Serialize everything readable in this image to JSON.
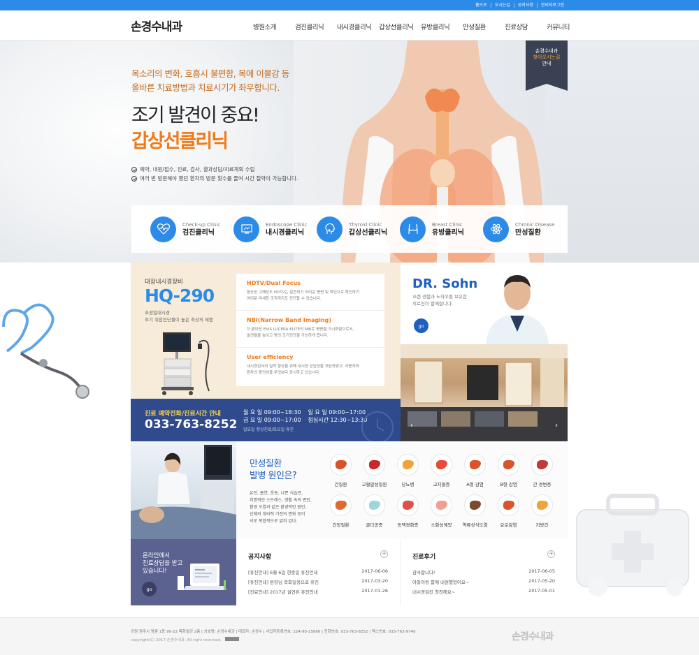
{
  "util_links": [
    "홈으로",
    "오시는길",
    "공지사항",
    "관리자로그인"
  ],
  "logo": "손경수내과",
  "nav": [
    "병원소개",
    "검진클리닉",
    "내시경클리닉",
    "갑상선클리닉",
    "유방클리닉",
    "만성질환",
    "진료상담",
    "커뮤니티"
  ],
  "hero": {
    "sub1": "목소리의 변화, 호흡시 불편함, 목에 이물감 등",
    "sub2": "올바른 치료방법과 치료시기가 좌우합니다.",
    "title1": "조기 발견이 중요!",
    "title2": "갑상선클리닉",
    "check1": "예약, 내원/접수, 진료, 검사, 결과상담/치료계획 수립",
    "check2": "여러 번 방문해야 했던 환자의 방문 횟수를 줄여 시간 절약이 가능합니다."
  },
  "badge": {
    "l1": "손경수내과",
    "l2": "찾아오시는길",
    "l3": "안내"
  },
  "clinics": [
    {
      "en": "Check-up Clinic",
      "ko": "검진클리닉",
      "icon": "heartbeat-icon"
    },
    {
      "en": "Endoscope Clinic",
      "ko": "내시경클리닉",
      "icon": "monitor-icon"
    },
    {
      "en": "Thyroid Clinic",
      "ko": "갑상선클리닉",
      "icon": "head-icon"
    },
    {
      "en": "Breast Clinic",
      "ko": "유방클리닉",
      "icon": "torso-icon"
    },
    {
      "en": "Chronic Disease",
      "ko": "만성질환",
      "icon": "atom-icon"
    }
  ],
  "promo": {
    "label": "대장내시경장비",
    "model": "HQ-290",
    "desc1": "초정밀내시경",
    "desc2": "조기 위암진단률이 높은 최상의 제품"
  },
  "features": [
    {
      "title": "HDTV/Dual Focus",
      "d1": "향상된 고해상도 HDTV는 발견되기 어려운 병변 및 확인으로 확인하기",
      "d2": "어려운 미세한 조직까지도 진단할 수 있습니다."
    },
    {
      "title": "NBI(Narrow Band Imaging)",
      "d1": "더 밝아진 EVIS LUCERA ELITE의 NBI로 병변을 가시화함으로서,",
      "d2": "발견율을 높이고 병의 조기진단을 가능하게 합니다."
    },
    {
      "title": "User efficiency",
      "d1": "내시경검사의 질적 향상을 위해 내시경 삽입성을 개선하였고, 사용자와",
      "d2": "환자의 편의성을 무엇보다 중시하고 있습니다."
    }
  ],
  "doctor": {
    "name": "DR. Sohn",
    "d1": "오랜 경험과 노하우를 보유한",
    "d2": "의료진이 함께합니다.",
    "go": "go"
  },
  "hours": {
    "title": "진료 예약전화/진료시간 안내",
    "tel": "033-763-8252",
    "r1a": "월 요 일  09:00~18:30",
    "r1b": "일 요 일  09:00~17:00",
    "r2a": "금 요 일  09:00~17:00",
    "r2b": "점심시간  12:30~13:30",
    "note": "일요일 정상진료/토요일 휴진"
  },
  "chronic": {
    "t1": "만성질환",
    "t2": "발병 원인은?",
    "desc": [
      "유전, 흡연, 운동, 나쁜 식습관,",
      "치명적인 스트레스, 생활 속의 변인,",
      "환경 오염과 같은 환경적인 원인,",
      "신체의 생리적 기전의 변화 등이",
      "서로 복합적으로 얽혀 있다."
    ],
    "diseases": [
      {
        "label": "간질환",
        "color": "#d9542b",
        "icon": "liver-icon"
      },
      {
        "label": "고혈압성질환",
        "color": "#c8282d",
        "icon": "heart-icon"
      },
      {
        "label": "당뇨병",
        "color": "#f2a23a",
        "icon": "pancreas-icon"
      },
      {
        "label": "고지혈증",
        "color": "#e84a3a",
        "icon": "vessel-icon"
      },
      {
        "label": "A형 감염",
        "color": "#d9542b",
        "icon": "liver-icon"
      },
      {
        "label": "B형 감염",
        "color": "#d9542b",
        "icon": "liver-icon"
      },
      {
        "label": "간 경변증",
        "color": "#c03a3a",
        "icon": "cirrhosis-icon"
      },
      {
        "label": "간장질환",
        "color": "#e06a2f",
        "icon": "liver-icon"
      },
      {
        "label": "골다공증",
        "color": "#9fd6d8",
        "icon": "bone-icon"
      },
      {
        "label": "동맥경화증",
        "color": "#e0504a",
        "icon": "artery-icon"
      },
      {
        "label": "소화성궤양",
        "color": "#f0a090",
        "icon": "stomach-icon"
      },
      {
        "label": "역류성식도염",
        "color": "#7a4a2a",
        "icon": "esophagus-icon"
      },
      {
        "label": "요로감염",
        "color": "#d9542b",
        "icon": "kidney-icon"
      },
      {
        "label": "지방간",
        "color": "#f2a23a",
        "icon": "fatty-liver-icon"
      }
    ]
  },
  "consult": {
    "l1": "온라인에서",
    "l2": "진료상담을 받고",
    "l3": "있습니다!",
    "go": "go"
  },
  "notice": {
    "title": "공지사항",
    "rows": [
      {
        "t": "[휴진안내] 6월 6일 현충일 휴진안내",
        "d": "2017-06-06"
      },
      {
        "t": "[휴진안내] 원장님 학회일정으로 휴진",
        "d": "2017-03-20"
      },
      {
        "t": "[진료안내] 2017년 설연휴 휴진안내",
        "d": "2017-01-26"
      }
    ]
  },
  "review": {
    "title": "진료후기",
    "rows": [
      {
        "t": "감사합니다!",
        "d": "2017-06-05"
      },
      {
        "t": "아들이랑 함께 내원했었어요~",
        "d": "2017-05-20"
      },
      {
        "t": "내시경검진 칭찬해요~",
        "d": "2017-05-01"
      }
    ]
  },
  "footer": {
    "line1": "강원 원주시 명륜 1동 90-22 목화빌딩 2층 | 상호명: 손경수내과 | 대표자: 손경수 | 사업자등록번호: 224-90-15866 | 전화번호: 033-763-8252 | 팩스번호: 033-763-9740",
    "line2": "copyright(C) 2017 손경수내과.  All right reserved.",
    "logo": "손경수내과"
  },
  "colors": {
    "brand": "#2d8be8",
    "accent": "#ef7a17",
    "navy": "#2f4b8e",
    "doctor": "#1f5fbf"
  }
}
